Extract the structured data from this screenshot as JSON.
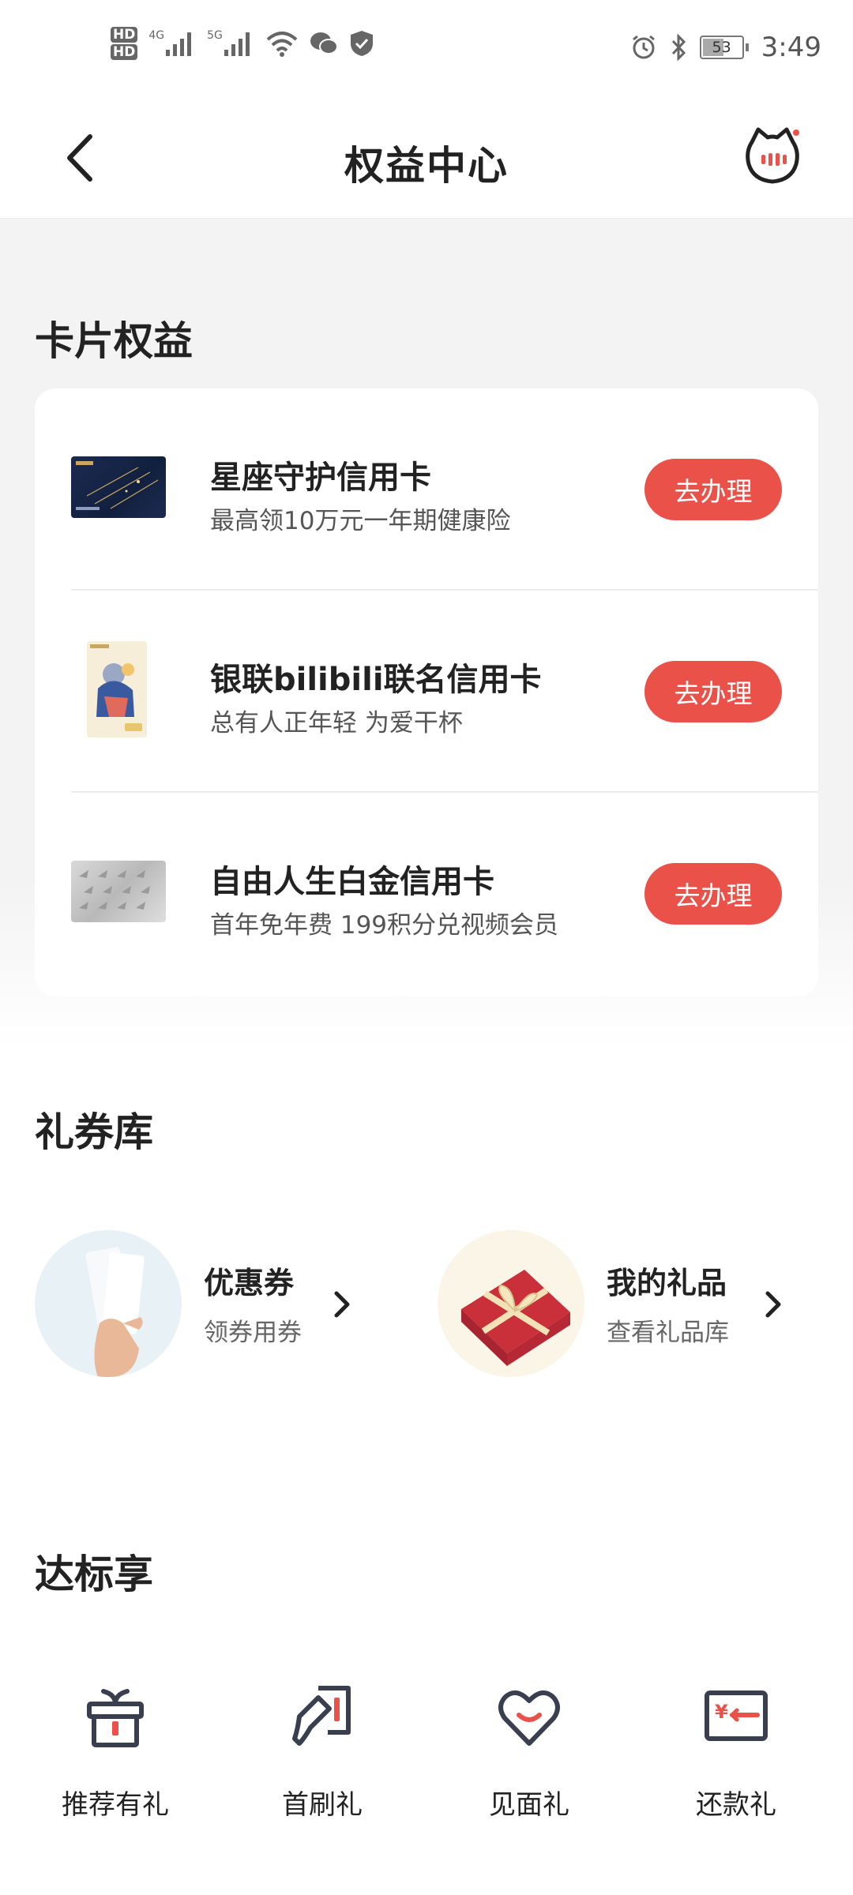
{
  "status_bar": {
    "time": "3:49",
    "battery": "53",
    "net_4g": "4G",
    "net_5g": "5G",
    "hd1": "HD",
    "hd2": "HD"
  },
  "header": {
    "title": "权益中心"
  },
  "card_section": {
    "title": "卡片权益",
    "cards": [
      {
        "name": "星座守护信用卡",
        "desc": "最高领10万元一年期健康险",
        "button": "去办理"
      },
      {
        "name": "银联bilibili联名信用卡",
        "desc": "总有人正年轻 为爱干杯",
        "button": "去办理"
      },
      {
        "name": "自由人生白金信用卡",
        "desc": "首年免年费 199积分兑视频会员",
        "button": "去办理"
      }
    ]
  },
  "coupon_section": {
    "title": "礼券库",
    "items": [
      {
        "title": "优惠券",
        "subtitle": "领券用券"
      },
      {
        "title": "我的礼品",
        "subtitle": "查看礼品库"
      }
    ]
  },
  "reward_section": {
    "title": "达标享",
    "items": [
      {
        "label": "推荐有礼",
        "icon": "gift-icon"
      },
      {
        "label": "首刷礼",
        "icon": "card-swipe-icon"
      },
      {
        "label": "见面礼",
        "icon": "heart-icon"
      },
      {
        "label": "还款礼",
        "icon": "repay-card-icon"
      }
    ]
  },
  "colors": {
    "accent": "#ea5249",
    "text": "#222222",
    "section_bg": "#f3f3f3"
  }
}
